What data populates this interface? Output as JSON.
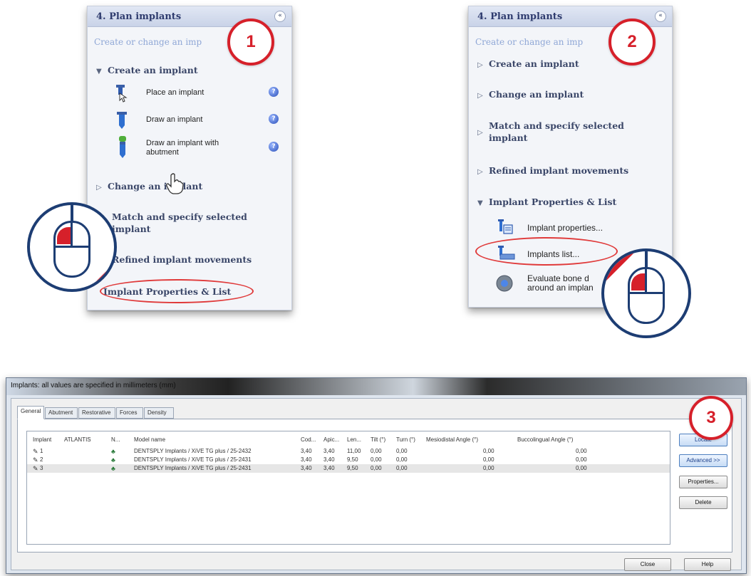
{
  "panel1": {
    "title": "4. Plan implants",
    "collapse_glyph": "«",
    "subtitle": "Create or change an imp",
    "sections": [
      {
        "label": "Create an implant",
        "expanded": true
      },
      {
        "label": "Change an implant",
        "expanded": false
      },
      {
        "label": "Match and specify selected implant",
        "expanded": false
      },
      {
        "label": "Refined implant movements",
        "expanded": false
      },
      {
        "label": "Implant Properties & List",
        "expanded": false
      }
    ],
    "tools": [
      {
        "label": "Place an implant",
        "icon": "place-implant-icon",
        "help": "?"
      },
      {
        "label": "Draw an implant",
        "icon": "draw-implant-icon",
        "help": "?"
      },
      {
        "label": "Draw an implant with abutment",
        "icon": "draw-implant-abutment-icon",
        "help": "?"
      }
    ]
  },
  "panel2": {
    "title": "4. Plan implants",
    "collapse_glyph": "«",
    "subtitle": "Create or change an imp",
    "sections": [
      {
        "label": "Create an implant",
        "expanded": false
      },
      {
        "label": "Change an implant",
        "expanded": false
      },
      {
        "label": "Match and specify selected implant",
        "expanded": false
      },
      {
        "label": "Refined implant movements",
        "expanded": false
      },
      {
        "label": "Implant Properties & List",
        "expanded": true
      }
    ],
    "tools": [
      {
        "label": "Implant properties...",
        "icon": "implant-properties-icon"
      },
      {
        "label": "Implants list...",
        "icon": "implants-list-icon"
      },
      {
        "label": "Evaluate bone d around an implan",
        "icon": "evaluate-bone-icon"
      }
    ]
  },
  "badges": {
    "step1": "1",
    "step2": "2",
    "step3": "3"
  },
  "dialog": {
    "title": "Implants: all values are specified in millimeters (mm)",
    "tabs": [
      "General",
      "Abutment",
      "Restorative",
      "Forces",
      "Density"
    ],
    "columns": [
      "Implant",
      "ATLANTIS",
      "N...",
      "Model name",
      "Cod...",
      "Apic...",
      "Len...",
      "Tilt (°)",
      "Turn (°)",
      "Mesiodistal Angle (°)",
      "Buccolingual Angle (°)"
    ],
    "rows": [
      {
        "implant": "1",
        "atlantis": "",
        "model": "DENTSPLY Implants / XiVE TG plus / 25-2432",
        "cod": "3,40",
        "apic": "3,40",
        "len": "11,00",
        "tilt": "0,00",
        "turn": "0,00",
        "md": "0,00",
        "bl": "0,00"
      },
      {
        "implant": "2",
        "atlantis": "",
        "model": "DENTSPLY Implants / XiVE TG plus / 25-2431",
        "cod": "3,40",
        "apic": "3,40",
        "len": "9,50",
        "tilt": "0,00",
        "turn": "0,00",
        "md": "0,00",
        "bl": "0,00"
      },
      {
        "implant": "3",
        "atlantis": "",
        "model": "DENTSPLY Implants / XiVE TG plus / 25-2431",
        "cod": "3,40",
        "apic": "3,40",
        "len": "9,50",
        "tilt": "0,00",
        "turn": "0,00",
        "md": "0,00",
        "bl": "0,00"
      }
    ],
    "buttons": {
      "locate": "Locate",
      "advanced": "Advanced >>",
      "properties": "Properties...",
      "delete": "Delete",
      "close": "Close",
      "help": "Help"
    }
  },
  "colors": {
    "accent_red": "#d6202a",
    "mouse_blue": "#1d3d73",
    "panel_header": "#c9d3e8"
  }
}
